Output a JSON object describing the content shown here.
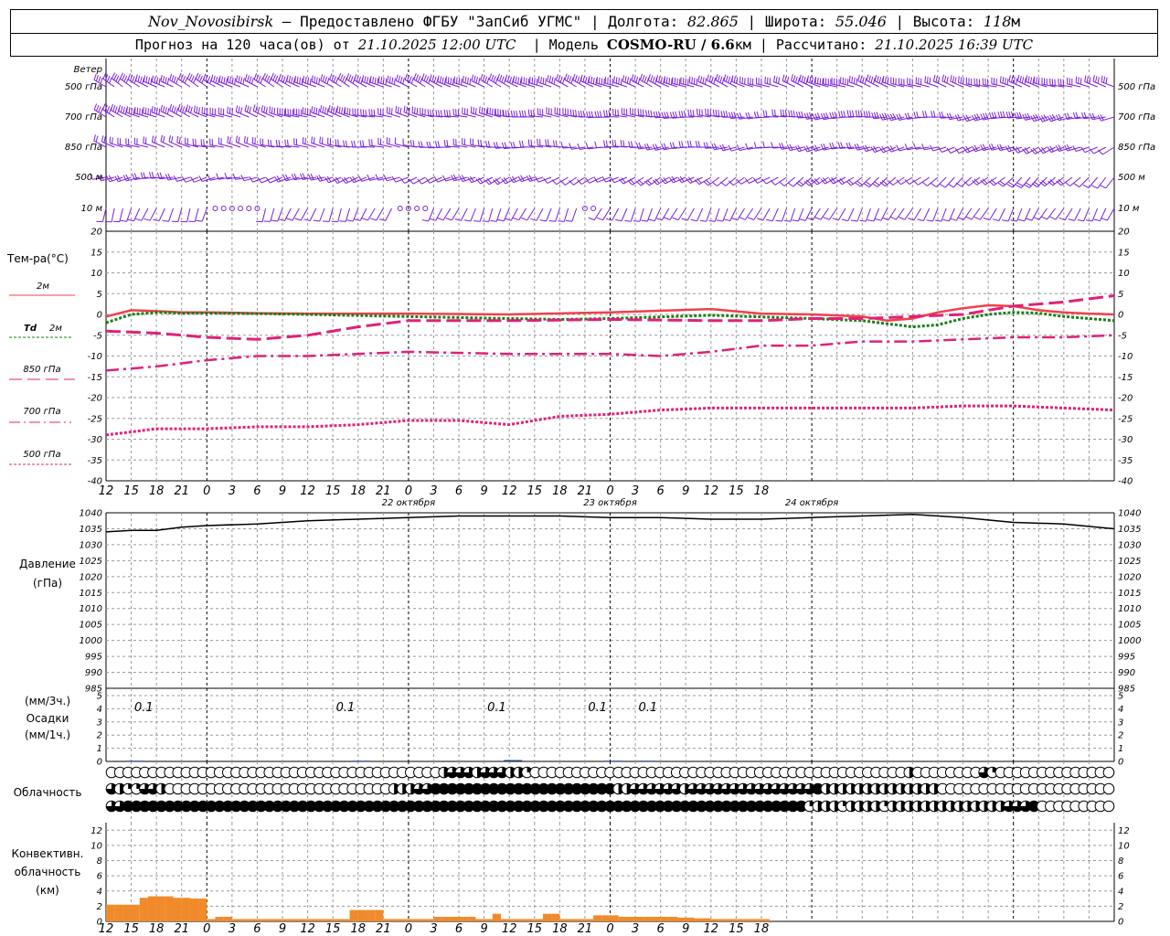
{
  "header": {
    "station": "Nov_Novosibirsk",
    "provider": "– Предоставлено ФГБУ \"ЗапСиб УГМС\"",
    "lon_label": "Долгота:",
    "lon": "82.865",
    "lat_label": "Широта:",
    "lat": "55.046",
    "alt_label": "Высота:",
    "alt": "118",
    "alt_unit": "м",
    "forecast_prefix": "Прогноз на 120 часа(ов) от",
    "forecast_start": "21.10.2025 12:00 UTC",
    "model_label": "Модель",
    "model": "COSMO-RU / 6.6",
    "model_unit": "км",
    "calc_label": "Рассчитано:",
    "calc_time": "21.10.2025 16:39 UTC"
  },
  "labels": {
    "wind": "Ветер",
    "wind_levels": [
      "500 гПа",
      "700 гПа",
      "850 гПа",
      "500 м",
      "10 м"
    ],
    "temp": "Тем-ра(°C)",
    "t2m": "2м",
    "td": "Td",
    "td_level": "2м",
    "t850": "850 гПа",
    "t700": "700 гПа",
    "t500": "500 гПа",
    "pressure": "Давление",
    "pressure_unit": "(гПа)",
    "precip_3h": "(мм/3ч.)",
    "precip": "Осадки",
    "precip_1h": "(мм/1ч.)",
    "cloud": "Облачность",
    "conv1": "Конвективн.",
    "conv2": "облачность",
    "conv3": "(км)"
  },
  "x_axis": {
    "tick_labels": [
      "12",
      "15",
      "18",
      "21",
      "0",
      "3",
      "6",
      "9",
      "12",
      "15",
      "18",
      "21",
      "0",
      "3",
      "6",
      "9",
      "12",
      "15",
      "18",
      "21",
      "0",
      "3",
      "6",
      "9",
      "12",
      "15",
      "18"
    ],
    "day_labels": [
      "22 октября",
      "23 октября",
      "24 октября"
    ]
  },
  "colors": {
    "wind": "#7a1fd6",
    "t2m": "#f0404a",
    "td": "#1a7f1a",
    "upper": "#e0207a",
    "pressure": "#000000",
    "precip": "#1a3a8a",
    "conv": "#f08a2a"
  },
  "chart_data": [
    {
      "type": "line",
      "title": "Тем-ра(°C)",
      "x_unit": "hours since 21.10.2025 12:00 UTC",
      "ylim": [
        -40,
        20
      ],
      "y_ticks": [
        20,
        15,
        10,
        5,
        0,
        -5,
        -10,
        -15,
        -20,
        -25,
        -30,
        -35,
        -40
      ],
      "grid": true,
      "series": [
        {
          "name": "2м",
          "x": [
            0,
            3,
            6,
            9,
            12,
            18,
            24,
            36,
            48,
            60,
            72,
            78,
            84,
            90,
            93,
            96,
            99,
            102,
            105,
            108,
            111,
            114,
            117,
            120
          ],
          "values": [
            -0.5,
            1.0,
            0.8,
            0.5,
            0.5,
            0.3,
            0.2,
            0.2,
            0.0,
            0.5,
            1.3,
            0.2,
            0.0,
            -0.5,
            -1.5,
            -1.0,
            0.5,
            1.5,
            2.2,
            2.0,
            1.0,
            0.5,
            0.2,
            0.0
          ]
        },
        {
          "name": "Td 2м",
          "x": [
            0,
            3,
            6,
            9,
            12,
            18,
            24,
            36,
            48,
            54,
            60,
            72,
            84,
            90,
            96,
            99,
            102,
            105,
            108,
            111,
            114,
            117,
            120
          ],
          "values": [
            -2.0,
            0.0,
            0.5,
            0.3,
            0.3,
            0.2,
            0.0,
            -0.5,
            -1.0,
            -1.2,
            -1.0,
            -0.2,
            -1.0,
            -1.5,
            -3.0,
            -2.5,
            -1.0,
            0.0,
            0.5,
            0.3,
            -0.5,
            -1.0,
            -1.5
          ]
        },
        {
          "name": "850 гПа",
          "x": [
            0,
            6,
            12,
            18,
            24,
            30,
            36,
            48,
            60,
            72,
            78,
            84,
            90,
            96,
            102,
            108,
            114,
            120
          ],
          "values": [
            -4.0,
            -4.5,
            -5.5,
            -6.0,
            -5.0,
            -3.0,
            -1.5,
            -1.5,
            -1.2,
            -1.5,
            -1.5,
            -1.0,
            -1.0,
            -0.5,
            0.0,
            2.0,
            3.0,
            4.5
          ]
        },
        {
          "name": "700 гПа",
          "x": [
            0,
            6,
            12,
            18,
            24,
            30,
            36,
            48,
            60,
            66,
            72,
            78,
            84,
            90,
            96,
            102,
            108,
            114,
            120
          ],
          "values": [
            -13.5,
            -12.5,
            -11.0,
            -10.0,
            -10.0,
            -9.5,
            -9.0,
            -9.5,
            -9.5,
            -10.0,
            -9.0,
            -7.5,
            -7.5,
            -6.5,
            -6.5,
            -6.0,
            -5.5,
            -5.5,
            -5.0
          ]
        },
        {
          "name": "500 гПа",
          "x": [
            0,
            6,
            12,
            18,
            24,
            30,
            36,
            42,
            48,
            54,
            60,
            66,
            72,
            78,
            84,
            90,
            96,
            102,
            108,
            114,
            120
          ],
          "values": [
            -29.0,
            -27.5,
            -27.5,
            -27.0,
            -27.0,
            -26.5,
            -25.5,
            -25.5,
            -26.5,
            -24.5,
            -24.0,
            -23.0,
            -22.5,
            -22.5,
            -22.5,
            -22.5,
            -22.5,
            -22.0,
            -22.0,
            -22.5,
            -23.0
          ]
        }
      ]
    },
    {
      "type": "line",
      "title": "Давление",
      "ylabel": "(гПа)",
      "ylim": [
        985,
        1040
      ],
      "y_ticks": [
        1040,
        1035,
        1030,
        1025,
        1020,
        1015,
        1010,
        1005,
        1000,
        995,
        990,
        985
      ],
      "grid": true,
      "series": [
        {
          "x": [
            0,
            3,
            6,
            9,
            12,
            18,
            24,
            30,
            36,
            42,
            48,
            54,
            60,
            66,
            72,
            78,
            84,
            90,
            96,
            102,
            108,
            114,
            120
          ],
          "values": [
            1034,
            1034.5,
            1034.5,
            1035.5,
            1036,
            1036.5,
            1037.5,
            1038,
            1038.5,
            1039,
            1039,
            1039,
            1038.5,
            1038.5,
            1038,
            1038,
            1038.5,
            1039,
            1039.5,
            1038.5,
            1037,
            1036.5,
            1035
          ]
        }
      ]
    },
    {
      "type": "bar",
      "title": "Осадки",
      "ylabel": "(мм/3ч.) (мм/1ч.)",
      "ylim": [
        0,
        5
      ],
      "y_ticks": [
        5,
        4,
        3,
        2,
        1,
        0
      ],
      "grid": true,
      "annotations": [
        {
          "x": 4.5,
          "text": "0.1"
        },
        {
          "x": 28.5,
          "text": "0.1"
        },
        {
          "x": 46.5,
          "text": "0.1"
        },
        {
          "x": 58.5,
          "text": "0.1"
        },
        {
          "x": 64.5,
          "text": "0.1"
        }
      ],
      "series": [
        {
          "x": [
            3,
            30,
            48,
            60,
            64
          ],
          "values": [
            0.05,
            0.05,
            0.1,
            0.05,
            0.05
          ]
        }
      ]
    },
    {
      "type": "table",
      "title": "Облачность",
      "note": "cloud cover fraction per hour, three layers (high, middle, low)",
      "rows": [
        {
          "layer": "high",
          "values": [
            0,
            0,
            0,
            0,
            0,
            0,
            0,
            0,
            0,
            0,
            0,
            0,
            0,
            0,
            0,
            0,
            0,
            0,
            0,
            0,
            0,
            0,
            0,
            0,
            0,
            0,
            0,
            0,
            0,
            0,
            0,
            0,
            0,
            0,
            0,
            0,
            0,
            0,
            0,
            0,
            0.5,
            0.75,
            0.75,
            0.75,
            0.5,
            0.75,
            0.75,
            0.75,
            0.5,
            0.5,
            0.25,
            0,
            0,
            0,
            0,
            0,
            0,
            0,
            0,
            0,
            0,
            0,
            0,
            0,
            0,
            0,
            0,
            0,
            0,
            0,
            0,
            0,
            0,
            0,
            0,
            0,
            0,
            0,
            0,
            0,
            0,
            0,
            0,
            0,
            0,
            0,
            0,
            0,
            0,
            0,
            0,
            0,
            0,
            0,
            0,
            0,
            0.5,
            0,
            0,
            0,
            0,
            0,
            0,
            0,
            0,
            0.75,
            0.25,
            0,
            0,
            0,
            0,
            0,
            0,
            0,
            0,
            0,
            0,
            0,
            0,
            0,
            0
          ]
        },
        {
          "layer": "middle",
          "values": [
            0.75,
            0.5,
            0.25,
            0.25,
            0.75,
            0.75,
            0.5,
            0,
            0,
            0,
            0,
            0,
            0,
            0,
            0,
            0,
            0,
            0,
            0,
            0,
            0,
            0,
            0,
            0,
            0,
            0,
            0,
            0,
            0,
            0,
            0,
            0,
            0,
            0,
            0.5,
            0.5,
            0.5,
            0.75,
            0.75,
            1,
            1,
            1,
            1,
            1,
            1,
            1,
            1,
            1,
            1,
            1,
            1,
            1,
            1,
            1,
            1,
            1,
            1,
            1,
            1,
            1,
            1,
            0.5,
            0.5,
            0.75,
            0.75,
            0.75,
            0.75,
            0.75,
            0.75,
            0.5,
            0.75,
            0.75,
            0.75,
            0.75,
            0.75,
            0.75,
            0.75,
            0.75,
            0.75,
            0.75,
            0.75,
            0.75,
            0.75,
            0.75,
            0.75,
            1,
            0.5,
            0.5,
            0.5,
            0.5,
            0.5,
            0.5,
            0.5,
            0.5,
            0.5,
            0.5,
            0.5,
            0.5,
            0.5,
            0.5,
            0,
            0,
            0,
            0,
            0,
            0,
            0,
            0,
            0,
            0,
            0,
            0,
            0,
            0,
            0,
            0,
            0,
            0,
            0,
            0,
            0
          ]
        },
        {
          "layer": "low",
          "values": [
            0.75,
            0.75,
            1,
            1,
            1,
            1,
            1,
            1,
            1,
            1,
            1,
            1,
            1,
            1,
            1,
            1,
            1,
            1,
            1,
            1,
            1,
            1,
            1,
            1,
            1,
            1,
            1,
            1,
            1,
            1,
            1,
            1,
            1,
            1,
            1,
            1,
            1,
            1,
            1,
            1,
            1,
            1,
            1,
            1,
            1,
            1,
            1,
            1,
            1,
            1,
            1,
            1,
            1,
            1,
            1,
            1,
            1,
            1,
            1,
            1,
            1,
            1,
            1,
            1,
            1,
            1,
            1,
            1,
            1,
            1,
            1,
            1,
            1,
            1,
            1,
            1,
            1,
            1,
            1,
            1,
            1,
            1,
            1,
            1,
            0.25,
            0.5,
            0.5,
            0.5,
            0.25,
            0.5,
            0.5,
            0.5,
            0.5,
            0.25,
            0.5,
            0.5,
            0.5,
            0.5,
            0.5,
            0.5,
            0.5,
            0.5,
            0.5,
            0.5,
            0.5,
            0.5,
            0.5,
            0.5,
            0.75,
            0.75,
            0.75,
            1,
            0,
            0,
            0,
            0,
            0,
            0,
            0,
            0,
            0
          ]
        }
      ]
    },
    {
      "type": "bar",
      "title": "Конвективн. облачность",
      "ylabel": "(км)",
      "ylim": [
        0,
        13
      ],
      "y_ticks": [
        12,
        10,
        8,
        6,
        4,
        2,
        0
      ],
      "grid": true,
      "series": [
        {
          "x": [
            0,
            1,
            2,
            3,
            4,
            5,
            6,
            7,
            8,
            9,
            10,
            11,
            12,
            13,
            14,
            15,
            16,
            17,
            18,
            19,
            20,
            21,
            22,
            23,
            24,
            25,
            26,
            27,
            28,
            29,
            30,
            31,
            32,
            33,
            34,
            35,
            36,
            37,
            38,
            39,
            40,
            41,
            42,
            43,
            44,
            45,
            46,
            47,
            48,
            49,
            50,
            51,
            52,
            53,
            54,
            55,
            56,
            57,
            58,
            59,
            60,
            61,
            62,
            63,
            64,
            65,
            66,
            67,
            68,
            69,
            70,
            71,
            72,
            73,
            74,
            75,
            76,
            77,
            78
          ],
          "values": [
            2.2,
            2.2,
            2.2,
            2.2,
            3.1,
            3.3,
            3.3,
            3.3,
            3.1,
            3.1,
            3.0,
            3.0,
            0.3,
            0.6,
            0.6,
            0.3,
            0.3,
            0.3,
            0.3,
            0.3,
            0.3,
            0.3,
            0.3,
            0.3,
            0.3,
            0.3,
            0.3,
            0.3,
            0.3,
            1.5,
            1.5,
            1.5,
            1.5,
            0.3,
            0.3,
            0.3,
            0.3,
            0.3,
            0.3,
            0.6,
            0.6,
            0.6,
            0.6,
            0.6,
            0.3,
            0.3,
            1.0,
            0.3,
            0.3,
            0.3,
            0.3,
            0.3,
            1.0,
            1.0,
            0.3,
            0.3,
            0.3,
            0.3,
            0.8,
            0.8,
            0.8,
            0.6,
            0.6,
            0.6,
            0.6,
            0.6,
            0.6,
            0.6,
            0.5,
            0.5,
            0.4,
            0.4,
            0.3,
            0.3,
            0.3,
            0.3,
            0.3,
            0.3,
            0.3
          ]
        }
      ]
    },
    {
      "type": "scatter",
      "title": "Ветер",
      "note": "wind barbs by level (dd° direction from, ff m/s)",
      "series": [
        {
          "name": "500 гПа",
          "dd_start": 300,
          "dd_end": 285,
          "ff_start": 25,
          "ff_end": 15
        },
        {
          "name": "700 гПа",
          "dd_start": 295,
          "dd_end": 255,
          "ff_start": 18,
          "ff_end": 12
        },
        {
          "name": "850 гПа",
          "dd_start": 290,
          "dd_end": 245,
          "ff_start": 10,
          "ff_end": 8
        },
        {
          "name": "500 м",
          "dd_start": 260,
          "dd_end": 225,
          "ff_start": 7,
          "ff_end": 8
        },
        {
          "name": "10 м",
          "dd_start": 200,
          "dd_end": 210,
          "ff_start": 2,
          "ff_end": 4
        }
      ]
    }
  ]
}
